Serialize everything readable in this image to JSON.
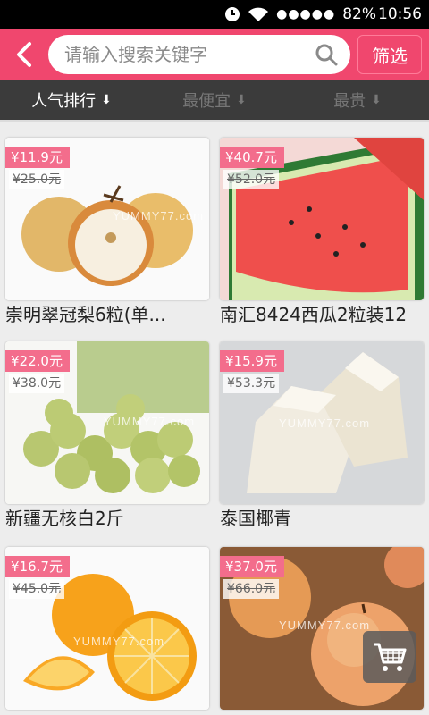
{
  "status_bar": {
    "battery": "82%",
    "time": "10:56",
    "signal": "●●●●●"
  },
  "header": {
    "search_placeholder": "请输入搜索关键字",
    "filter_label": "筛选"
  },
  "sort_tabs": [
    {
      "label": "人气排行",
      "active": true
    },
    {
      "label": "最便宜",
      "active": false
    },
    {
      "label": "最贵",
      "active": false
    }
  ],
  "products": [
    {
      "price": "¥11.9元",
      "old_price": "¥25.0元",
      "title": "崇明翠冠梨6粒(单..."
    },
    {
      "price": "¥40.7元",
      "old_price": "¥52.0元",
      "title": "南汇8424西瓜2粒装12"
    },
    {
      "price": "¥22.0元",
      "old_price": "¥38.0元",
      "title": "新疆无核白2斤"
    },
    {
      "price": "¥15.9元",
      "old_price": "¥53.3元",
      "title": "泰国椰青"
    },
    {
      "price": "¥16.7元",
      "old_price": "¥45.0元",
      "title": ""
    },
    {
      "price": "¥37.0元",
      "old_price": "¥66.0元",
      "title": ""
    }
  ],
  "watermark": "YUMMY77.com",
  "colors": {
    "brand": "#f0476e",
    "tab_bar": "#3b3b3b",
    "price_tag": "#f36d8c"
  }
}
